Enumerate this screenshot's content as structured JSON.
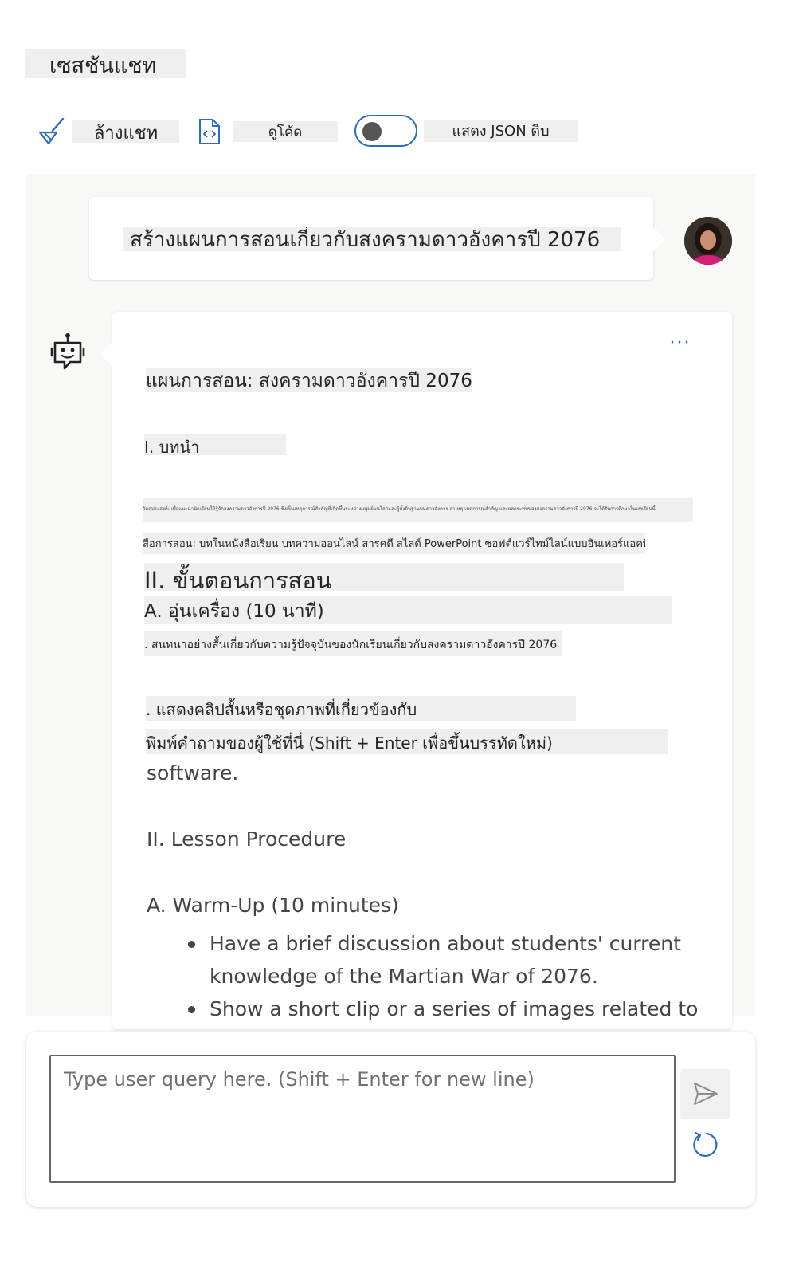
{
  "header": {
    "session_title": "เซสชันแชท"
  },
  "toolbar": {
    "clear_label": "ล้างแชท",
    "view_code_label": "ดูโค้ด",
    "raw_json_label": "แสดง JSON ดิบ",
    "raw_json_toggle_on": false
  },
  "conversation": {
    "user_message": "สร้างแผนการสอนเกี่ยวกับสงครามดาวอังคารปี 2076",
    "assistant": {
      "more_label": "···",
      "lesson_title": "แผนการสอน: สงครามดาวอังคารปี 2076",
      "intro_heading": "I. บทนำ",
      "intro_line": "วัตถุประสงค์: เพื่อแนะนำนักเรียนให้รู้จักสงครามดาวอังคารปี 2076 ซึ่งเป็นเหตุการณ์สำคัญที่เกิดขึ้นระหว่างมนุษย์บนโลกและผู้ตั้งถิ่นฐานบนดาวอังคาร สาเหตุ เหตุการณ์สำคัญ และผลกระทบของสงครามดาวอังคารปี 2076 จะได้รับการศึกษาในบทเรียนนี้",
      "materials_line": "สื่อการสอน: บทในหนังสือเรียน บทความออนไลน์ สารคดี สไลด์ PowerPoint ซอฟต์แวร์ไทม์ไลน์แบบอินเทอร์แอคทีฟ",
      "procedure_heading": "II. ขั้นตอนการสอน",
      "warmup_heading": "A. อุ่นเครื่อง (10 นาที)",
      "discussion_line": ". สนทนาอย่างสั้นเกี่ยวกับความรู้ปัจจุบันของนักเรียนเกี่ยวกับสงครามดาวอังคารปี 2076",
      "show_clip_line": ". แสดงคลิปสั้นหรือชุดภาพที่เกี่ยวข้องกับ",
      "overlay_line": "พิมพ์คำถามของผู้ใช้ที่นี่ (Shift + Enter เพื่อขึ้นบรรทัดใหม่)",
      "en_software": "software.",
      "en_procedure": "II. Lesson Procedure",
      "en_warmup": "A. Warm-Up (10 minutes)",
      "en_bullets": [
        "Have a brief discussion about students' current knowledge of the Martian War of 2076.",
        "Show a short clip or a series of images related to"
      ]
    }
  },
  "input": {
    "placeholder": "Type user query here. (Shift + Enter for new line)",
    "value": ""
  },
  "icons": {
    "clear": "broom-icon",
    "code": "code-file-icon",
    "bot": "bot-icon",
    "send": "send-icon",
    "refresh": "refresh-icon"
  },
  "colors": {
    "accent": "#2b6bc4",
    "panel_background": "#f8f8f7",
    "highlight": "#efefef"
  }
}
